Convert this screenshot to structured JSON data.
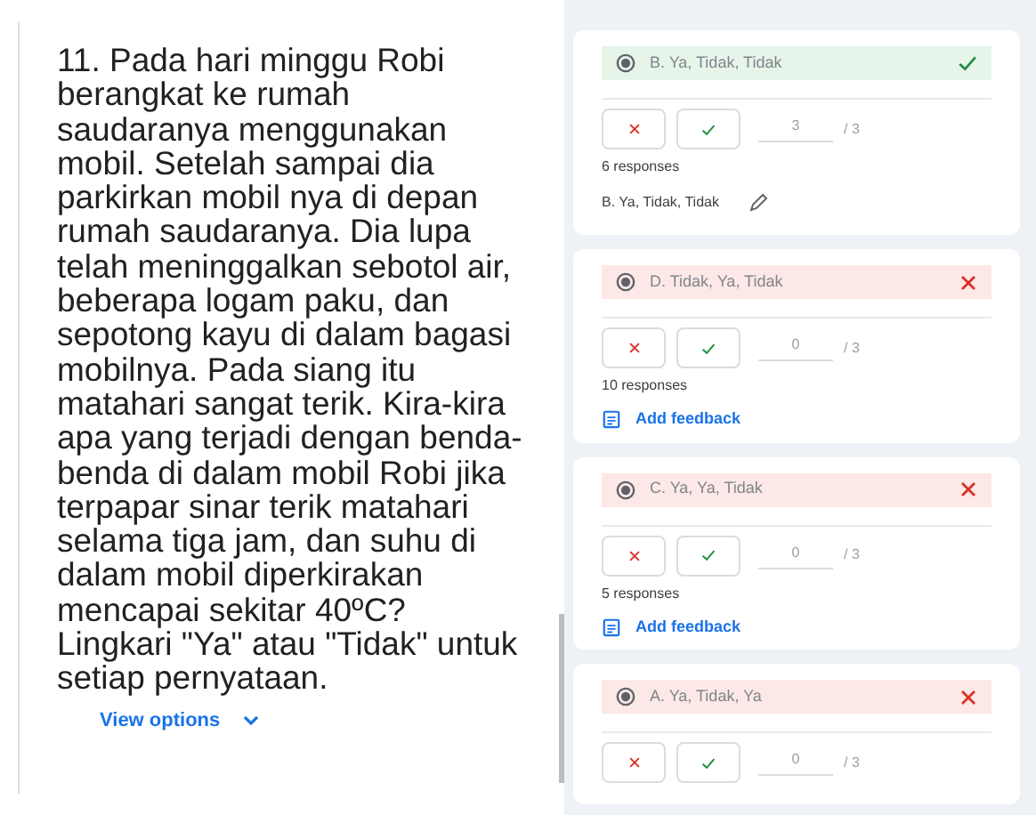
{
  "question": {
    "text": "11. Pada hari minggu Robi berangkat ke rumah saudaranya menggunakan mobil. Setelah sampai dia parkirkan mobil nya di depan rumah saudaranya. Dia lupa telah meninggalkan sebotol air, beberapa logam paku, dan sepotong kayu di dalam bagasi mobilnya. Pada siang itu matahari sangat terik. Kira-kira apa yang terjadi dengan benda-benda di dalam mobil Robi jika terpapar sinar terik matahari selama tiga jam, dan suhu di dalam mobil diperkirakan mencapai sekitar 40ºC? Lingkari \"Ya\" atau \"Tidak\" untuk setiap pernyataan.",
    "view_options": "View options"
  },
  "answers": [
    {
      "option": "B. Ya, Tidak, Tidak",
      "correct": true,
      "score": "3",
      "max": "/ 3",
      "responses": "6 responses",
      "footer": {
        "kind": "answer",
        "text": "B. Ya, Tidak, Tidak"
      }
    },
    {
      "option": "D. Tidak, Ya, Tidak",
      "correct": false,
      "score": "0",
      "max": "/ 3",
      "responses": "10 responses",
      "footer": {
        "kind": "feedback",
        "text": "Add feedback"
      }
    },
    {
      "option": "C. Ya, Ya, Tidak",
      "correct": false,
      "score": "0",
      "max": "/ 3",
      "responses": "5 responses",
      "footer": {
        "kind": "feedback",
        "text": "Add feedback"
      }
    },
    {
      "option": "A. Ya, Tidak, Ya",
      "correct": false,
      "score": "0",
      "max": "/ 3"
    }
  ]
}
